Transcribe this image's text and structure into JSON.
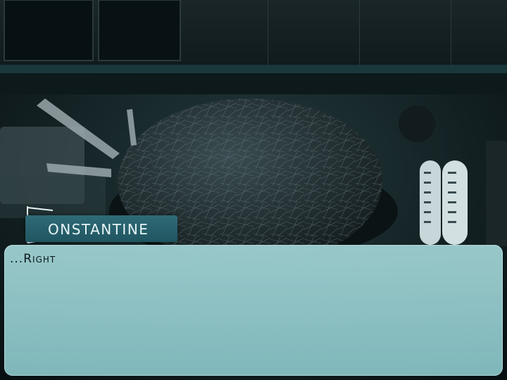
{
  "speaker": {
    "name": "ONSTANTINE"
  },
  "dialog": {
    "text": "...Right"
  }
}
